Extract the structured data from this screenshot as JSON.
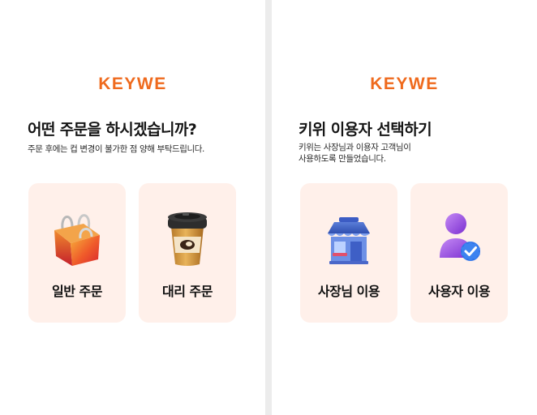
{
  "left_screen": {
    "logo": "KEYWE",
    "title": "어떤 주문을 하시겠습니까?",
    "subtitle": "주문 후에는 컵 변경이 불가한 점 양해 부탁드립니다.",
    "options": [
      {
        "label": "일반 주문",
        "icon": "shopping-bag-icon"
      },
      {
        "label": "대리 주문",
        "icon": "coffee-cup-icon"
      }
    ]
  },
  "right_screen": {
    "logo": "KEYWE",
    "title": "키위 이용자 선택하기",
    "subtitle": "키위는 사장님과 이용자 고객님이\n사용하도록 만들었습니다.",
    "options": [
      {
        "label": "사장님 이용",
        "icon": "store-icon"
      },
      {
        "label": "사용자 이용",
        "icon": "verified-user-icon"
      }
    ]
  },
  "colors": {
    "brand": "#ef6a1d",
    "card_background": "#fff0ea",
    "divider": "#ececec"
  }
}
